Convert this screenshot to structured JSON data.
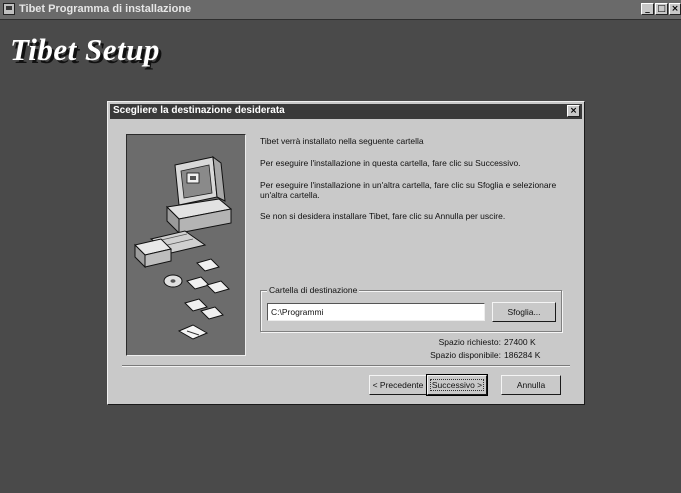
{
  "window": {
    "title": "Tibet Programma di installazione"
  },
  "window_controls": {
    "minimize": "_",
    "maximize": "□",
    "close": "×"
  },
  "setup_title": "Tibet Setup",
  "dialog": {
    "title": "Scegliere la destinazione desiderata",
    "close": "×",
    "messages": [
      "Tibet verrà installato nella seguente cartella",
      "Per eseguire l'installazione in questa cartella, fare clic su Successivo.",
      "Per eseguire l'installazione in un'altra cartella, fare clic su Sfoglia e selezionare un'altra cartella.",
      "Se non si desidera installare Tibet, fare clic su Annulla per uscire."
    ],
    "destination": {
      "group_label": "Cartella di destinazione",
      "path": "C:\\Programmi",
      "browse_label": "Sfoglia..."
    },
    "space": {
      "required_label": "Spazio richiesto:",
      "required_value": "27400 K",
      "available_label": "Spazio disponibile:",
      "available_value": "186284 K"
    },
    "buttons": {
      "back": "< Precedente",
      "next": "Successivo >",
      "cancel": "Annulla"
    }
  },
  "icons": [
    "computer-icon",
    "floppy-disk-icon",
    "cd-icon",
    "folder-icon"
  ]
}
